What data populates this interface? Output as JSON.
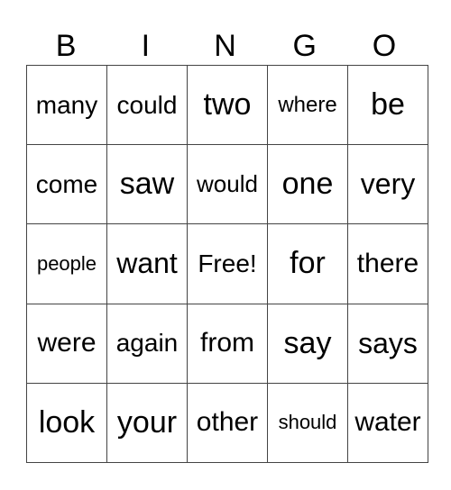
{
  "card": {
    "header": [
      "B",
      "I",
      "N",
      "G",
      "O"
    ],
    "rows": [
      [
        "many",
        "could",
        "two",
        "where",
        "be"
      ],
      [
        "come",
        "saw",
        "would",
        "one",
        "very"
      ],
      [
        "people",
        "want",
        "Free!",
        "for",
        "there"
      ],
      [
        "were",
        "again",
        "from",
        "say",
        "says"
      ],
      [
        "look",
        "your",
        "other",
        "should",
        "water"
      ]
    ]
  }
}
